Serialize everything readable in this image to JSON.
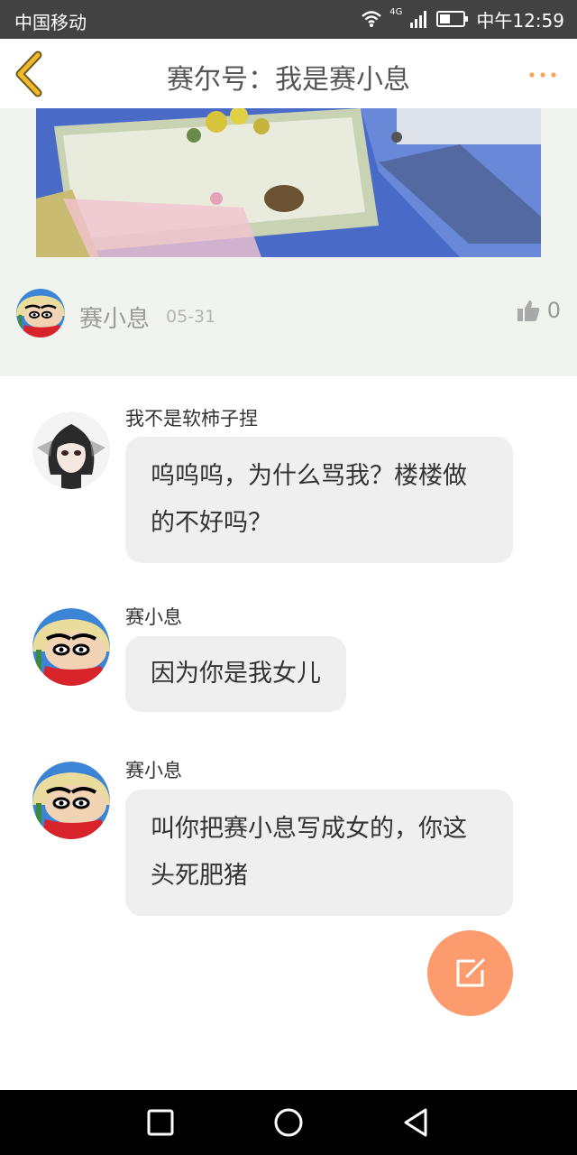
{
  "status_bar": {
    "carrier": "中国移动",
    "network": "4G",
    "time": "中午12:59"
  },
  "header": {
    "title": "赛尔号：我是赛小息"
  },
  "post": {
    "author": "赛小息",
    "date": "05-31",
    "likes": "0"
  },
  "comments": [
    {
      "user": "我不是软柿子捏",
      "text": "呜呜呜，为什么骂我？楼楼做的不好吗？"
    },
    {
      "user": "赛小息",
      "text": "因为你是我女儿"
    },
    {
      "user": "赛小息",
      "text": "叫你把赛小息写成女的，你这头死肥猪"
    }
  ],
  "colors": {
    "accent": "#fb9b6e",
    "back_arrow": "#f0b82a",
    "more_dots": "#f6a35a",
    "post_bg": "#f1f3ee",
    "bubble_bg": "#efefef"
  }
}
